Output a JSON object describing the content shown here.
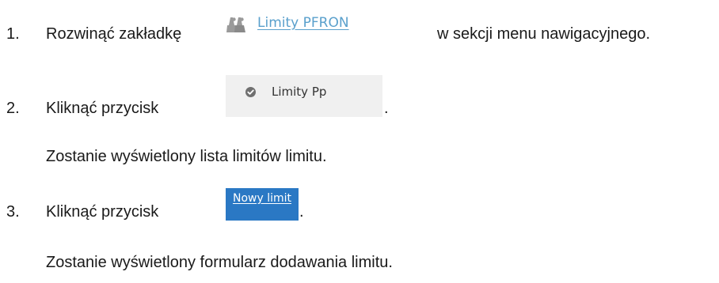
{
  "steps": [
    {
      "number": "1.",
      "text_before": "Rozwinąć zakładkę",
      "text_after": "w sekcji menu nawigacyjnego.",
      "link": {
        "label": "Limity PFRON",
        "icon": "people-group-icon"
      }
    },
    {
      "number": "2.",
      "text_before": "Kliknąć przycisk",
      "text_after": ".",
      "button": {
        "label": "Limity Pp",
        "icon": "check-circle-icon"
      },
      "note": "Zostanie wyświetlony lista limitów limitu."
    },
    {
      "number": "3.",
      "text_before": "Kliknąć przycisk",
      "text_after": ".",
      "button": {
        "label": "Nowy limit"
      },
      "note": "Zostanie wyświetlony formularz dodawania limitu."
    }
  ],
  "colors": {
    "link": "#5aa0cc",
    "icon_gray": "#9a9a9a",
    "button_gray_bg": "#f0f0f0",
    "button_blue_bg": "#2a78c4"
  }
}
